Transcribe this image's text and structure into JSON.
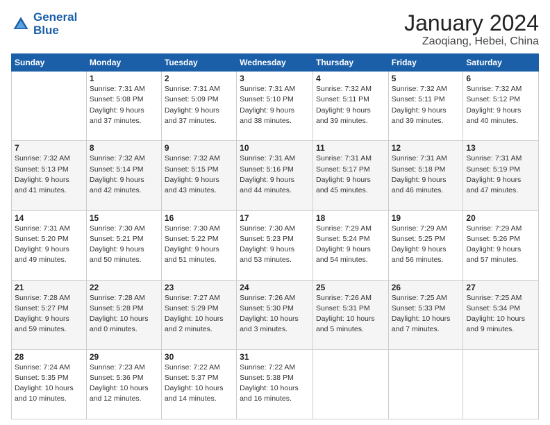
{
  "logo": {
    "line1": "General",
    "line2": "Blue"
  },
  "title": "January 2024",
  "subtitle": "Zaoqiang, Hebei, China",
  "weekdays": [
    "Sunday",
    "Monday",
    "Tuesday",
    "Wednesday",
    "Thursday",
    "Friday",
    "Saturday"
  ],
  "weeks": [
    [
      {
        "day": "",
        "info": ""
      },
      {
        "day": "1",
        "info": "Sunrise: 7:31 AM\nSunset: 5:08 PM\nDaylight: 9 hours\nand 37 minutes."
      },
      {
        "day": "2",
        "info": "Sunrise: 7:31 AM\nSunset: 5:09 PM\nDaylight: 9 hours\nand 37 minutes."
      },
      {
        "day": "3",
        "info": "Sunrise: 7:31 AM\nSunset: 5:10 PM\nDaylight: 9 hours\nand 38 minutes."
      },
      {
        "day": "4",
        "info": "Sunrise: 7:32 AM\nSunset: 5:11 PM\nDaylight: 9 hours\nand 39 minutes."
      },
      {
        "day": "5",
        "info": "Sunrise: 7:32 AM\nSunset: 5:11 PM\nDaylight: 9 hours\nand 39 minutes."
      },
      {
        "day": "6",
        "info": "Sunrise: 7:32 AM\nSunset: 5:12 PM\nDaylight: 9 hours\nand 40 minutes."
      }
    ],
    [
      {
        "day": "7",
        "info": "Sunrise: 7:32 AM\nSunset: 5:13 PM\nDaylight: 9 hours\nand 41 minutes."
      },
      {
        "day": "8",
        "info": "Sunrise: 7:32 AM\nSunset: 5:14 PM\nDaylight: 9 hours\nand 42 minutes."
      },
      {
        "day": "9",
        "info": "Sunrise: 7:32 AM\nSunset: 5:15 PM\nDaylight: 9 hours\nand 43 minutes."
      },
      {
        "day": "10",
        "info": "Sunrise: 7:31 AM\nSunset: 5:16 PM\nDaylight: 9 hours\nand 44 minutes."
      },
      {
        "day": "11",
        "info": "Sunrise: 7:31 AM\nSunset: 5:17 PM\nDaylight: 9 hours\nand 45 minutes."
      },
      {
        "day": "12",
        "info": "Sunrise: 7:31 AM\nSunset: 5:18 PM\nDaylight: 9 hours\nand 46 minutes."
      },
      {
        "day": "13",
        "info": "Sunrise: 7:31 AM\nSunset: 5:19 PM\nDaylight: 9 hours\nand 47 minutes."
      }
    ],
    [
      {
        "day": "14",
        "info": "Sunrise: 7:31 AM\nSunset: 5:20 PM\nDaylight: 9 hours\nand 49 minutes."
      },
      {
        "day": "15",
        "info": "Sunrise: 7:30 AM\nSunset: 5:21 PM\nDaylight: 9 hours\nand 50 minutes."
      },
      {
        "day": "16",
        "info": "Sunrise: 7:30 AM\nSunset: 5:22 PM\nDaylight: 9 hours\nand 51 minutes."
      },
      {
        "day": "17",
        "info": "Sunrise: 7:30 AM\nSunset: 5:23 PM\nDaylight: 9 hours\nand 53 minutes."
      },
      {
        "day": "18",
        "info": "Sunrise: 7:29 AM\nSunset: 5:24 PM\nDaylight: 9 hours\nand 54 minutes."
      },
      {
        "day": "19",
        "info": "Sunrise: 7:29 AM\nSunset: 5:25 PM\nDaylight: 9 hours\nand 56 minutes."
      },
      {
        "day": "20",
        "info": "Sunrise: 7:29 AM\nSunset: 5:26 PM\nDaylight: 9 hours\nand 57 minutes."
      }
    ],
    [
      {
        "day": "21",
        "info": "Sunrise: 7:28 AM\nSunset: 5:27 PM\nDaylight: 9 hours\nand 59 minutes."
      },
      {
        "day": "22",
        "info": "Sunrise: 7:28 AM\nSunset: 5:28 PM\nDaylight: 10 hours\nand 0 minutes."
      },
      {
        "day": "23",
        "info": "Sunrise: 7:27 AM\nSunset: 5:29 PM\nDaylight: 10 hours\nand 2 minutes."
      },
      {
        "day": "24",
        "info": "Sunrise: 7:26 AM\nSunset: 5:30 PM\nDaylight: 10 hours\nand 3 minutes."
      },
      {
        "day": "25",
        "info": "Sunrise: 7:26 AM\nSunset: 5:31 PM\nDaylight: 10 hours\nand 5 minutes."
      },
      {
        "day": "26",
        "info": "Sunrise: 7:25 AM\nSunset: 5:33 PM\nDaylight: 10 hours\nand 7 minutes."
      },
      {
        "day": "27",
        "info": "Sunrise: 7:25 AM\nSunset: 5:34 PM\nDaylight: 10 hours\nand 9 minutes."
      }
    ],
    [
      {
        "day": "28",
        "info": "Sunrise: 7:24 AM\nSunset: 5:35 PM\nDaylight: 10 hours\nand 10 minutes."
      },
      {
        "day": "29",
        "info": "Sunrise: 7:23 AM\nSunset: 5:36 PM\nDaylight: 10 hours\nand 12 minutes."
      },
      {
        "day": "30",
        "info": "Sunrise: 7:22 AM\nSunset: 5:37 PM\nDaylight: 10 hours\nand 14 minutes."
      },
      {
        "day": "31",
        "info": "Sunrise: 7:22 AM\nSunset: 5:38 PM\nDaylight: 10 hours\nand 16 minutes."
      },
      {
        "day": "",
        "info": ""
      },
      {
        "day": "",
        "info": ""
      },
      {
        "day": "",
        "info": ""
      }
    ]
  ]
}
